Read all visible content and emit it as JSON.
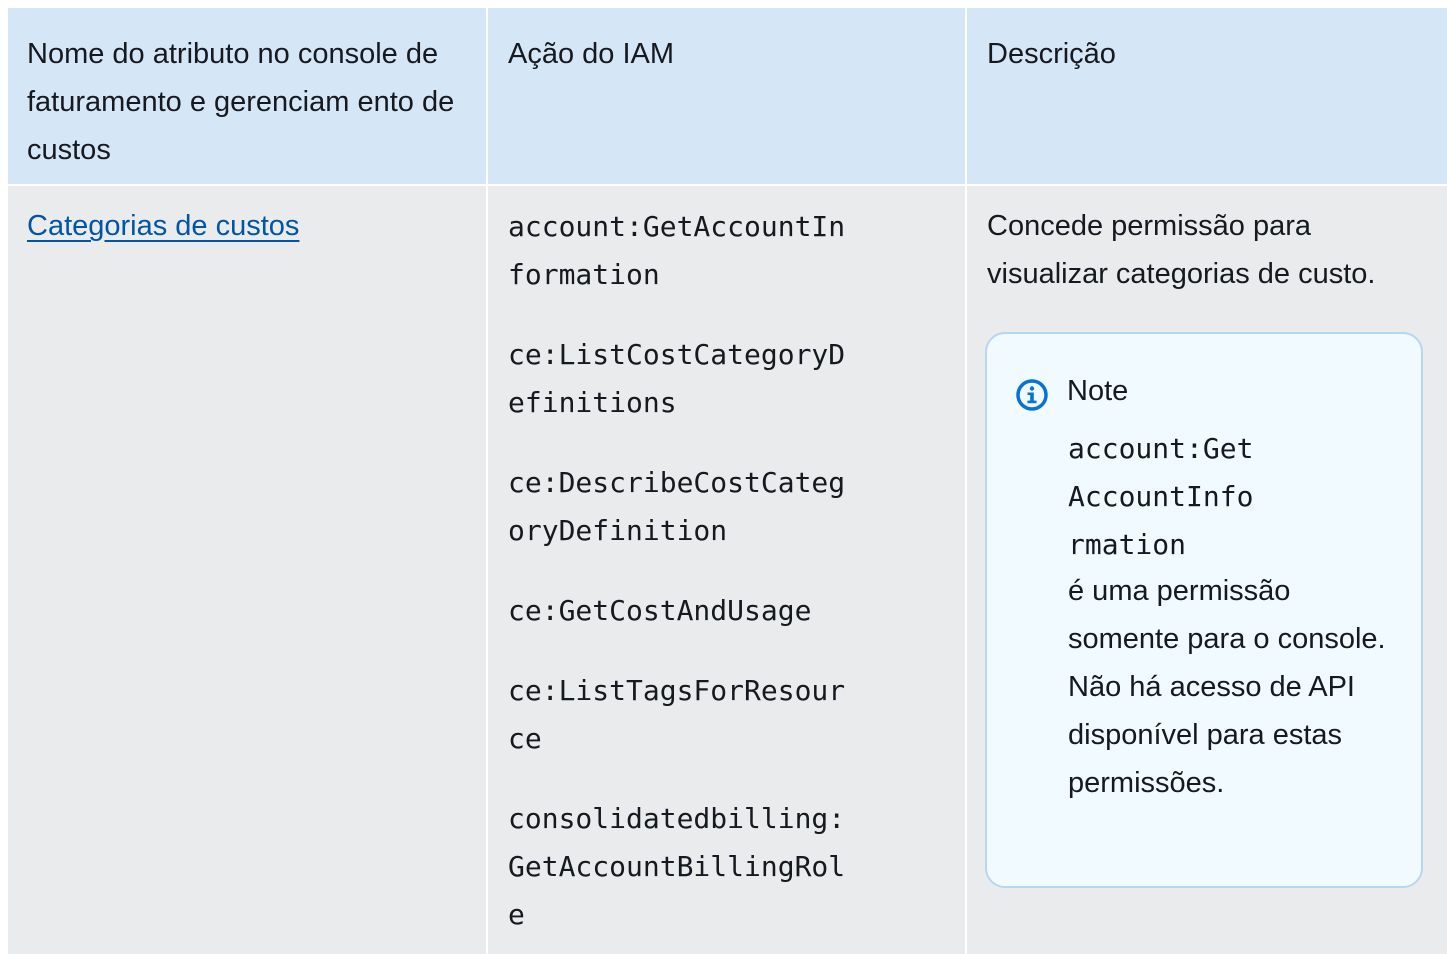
{
  "table": {
    "headers": [
      "Nome do atributo no console de faturamento e gerenciam ento de custos",
      "Ação do IAM",
      "Descrição"
    ],
    "rows": [
      {
        "attribute_link": "Categorias de custos",
        "iam_actions": [
          "account:GetAccountInformation",
          "ce:ListCostCategoryDefinitions",
          "ce:DescribeCostCategoryDefinition",
          "ce:GetCostAndUsage",
          "ce:ListTagsForResource",
          "consolidatedbilling:GetAccountBillingRole"
        ],
        "description": "Concede permissão para visualizar categorias de custo.",
        "note": {
          "icon": "info-circle-icon",
          "title": "Note",
          "code": "account:GetAccountInformation",
          "text": "é uma permissão somente para o console. Não há acesso de API disponível para estas permissões."
        }
      }
    ]
  },
  "colors": {
    "header_bg": "#d5e6f6",
    "row_bg": "#e9ebed",
    "link": "#0055a4",
    "note_bg": "#f1faff",
    "note_border": "#b5d6f4",
    "info_icon": "#0972d3"
  }
}
